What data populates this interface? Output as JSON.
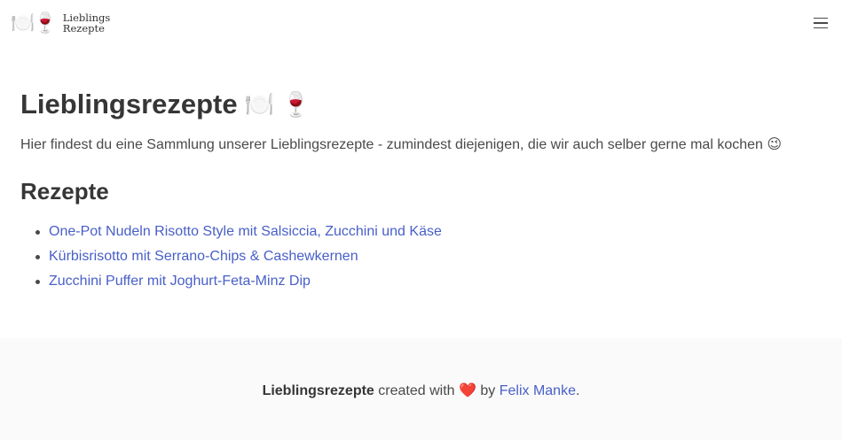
{
  "navbar": {
    "brand_emoji": "🍽️🍷",
    "brand_line1": "Lieblings",
    "brand_line2": "Rezepte"
  },
  "main": {
    "title": "Lieblingsrezepte",
    "title_emoji": "🍽️ 🍷",
    "intro": "Hier findest du eine Sammlung unserer Lieblingsrezepte - zumindest diejenigen, die wir auch selber gerne mal kochen 😉",
    "section_heading": "Rezepte",
    "recipes": [
      "One-Pot Nudeln Risotto Style mit Salsiccia, Zucchini und Käse",
      "Kürbisrisotto mit Serrano-Chips & Cashewkernen",
      "Zucchini Puffer mit Joghurt-Feta-Minz Dip"
    ]
  },
  "footer": {
    "site_name": "Lieblingsrezepte",
    "created_with": "created with",
    "heart": "❤️",
    "by": "by",
    "author": "Felix Manke",
    "period": "."
  },
  "colors": {
    "link": "#485fc7",
    "text": "#363636",
    "footer_bg": "#fafafa"
  }
}
